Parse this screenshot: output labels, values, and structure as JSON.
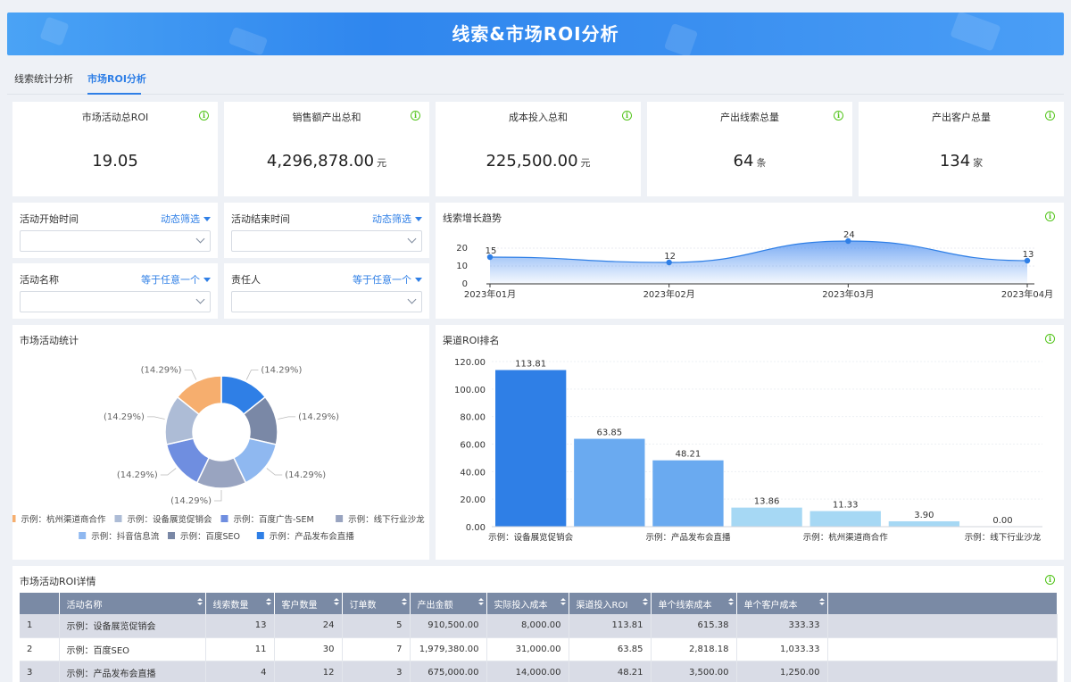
{
  "banner": {
    "title": "线索&市场ROI分析"
  },
  "tabs": [
    {
      "label": "线索统计分析"
    },
    {
      "label": "市场ROI分析"
    }
  ],
  "kpis": [
    {
      "label": "市场活动总ROI",
      "value": "19.05",
      "unit": ""
    },
    {
      "label": "销售额产出总和",
      "value": "4,296,878.00",
      "unit": "元"
    },
    {
      "label": "成本投入总和",
      "value": "225,500.00",
      "unit": "元"
    },
    {
      "label": "产出线索总量",
      "value": "64",
      "unit": "条"
    },
    {
      "label": "产出客户总量",
      "value": "134",
      "unit": "家"
    }
  ],
  "filters": [
    {
      "label": "活动开始时间",
      "mode": "动态筛选"
    },
    {
      "label": "活动结束时间",
      "mode": "动态筛选"
    },
    {
      "label": "活动名称",
      "mode": "等于任意一个"
    },
    {
      "label": "责任人",
      "mode": "等于任意一个"
    }
  ],
  "info_icon": "i",
  "colors": {
    "accent": "#2f7fe6",
    "info": "#52c41a"
  },
  "lead_trend": {
    "title": "线索增长趋势"
  },
  "activity_stats": {
    "title": "市场活动统计"
  },
  "channel_roi": {
    "title": "渠道ROI排名"
  },
  "chart_data": [
    {
      "type": "area",
      "title": "线索增长趋势",
      "x": [
        "2023年01月",
        "2023年02月",
        "2023年03月",
        "2023年04月"
      ],
      "y": [
        15,
        12,
        24,
        13
      ],
      "yticks": [
        0,
        10,
        20
      ],
      "ylim": [
        0,
        30
      ],
      "grid": true
    },
    {
      "type": "pie",
      "title": "市场活动统计",
      "donut": true,
      "legend": "bottom",
      "slices": [
        {
          "name": "示例：产品发布会直播",
          "value": 14.29,
          "label": "(14.29%)",
          "color": "#2f7fe6"
        },
        {
          "name": "示例：百度SEO",
          "value": 14.29,
          "label": "(14.29%)",
          "color": "#7a88a6"
        },
        {
          "name": "示例：抖音信息流",
          "value": 14.29,
          "label": "(14.29%)",
          "color": "#8fb8f0"
        },
        {
          "name": "示例：线下行业沙龙",
          "value": 14.29,
          "label": "(14.29%)",
          "color": "#99a4c0"
        },
        {
          "name": "示例：百度广告-SEM",
          "value": 14.29,
          "label": "(14.29%)",
          "color": "#6f8ee0"
        },
        {
          "name": "示例：设备展览促销会",
          "value": 14.29,
          "label": "(14.29%)",
          "color": "#adbcd6"
        },
        {
          "name": "示例：杭州渠道商合作",
          "value": 14.29,
          "label": "(14.29%)",
          "color": "#f6ae6e"
        }
      ],
      "legend_order": [
        "示例：杭州渠道商合作",
        "示例：设备展览促销会",
        "示例：百度广告-SEM",
        "示例：线下行业沙龙",
        "示例：抖音信息流",
        "示例：百度SEO",
        "示例：产品发布会直播"
      ]
    },
    {
      "type": "bar",
      "title": "渠道ROI排名",
      "categories": [
        "示例：设备展览促销会",
        "示例：百度SEO",
        "示例：产品发布会直播",
        "示例：抖音信息流",
        "示例：杭州渠道商合作",
        "示例：百度广告-SEM",
        "示例：线下行业沙龙"
      ],
      "values": [
        113.81,
        63.85,
        48.21,
        13.86,
        11.33,
        3.9,
        0.0
      ],
      "value_labels": [
        "113.81",
        "63.85",
        "48.21",
        "13.86",
        "11.33",
        "3.90",
        "0.00"
      ],
      "shown_xticks": [
        "示例：设备展览促销会",
        "示例：产品发布会直播",
        "示例：杭州渠道商合作",
        "示例：线下行业沙龙"
      ],
      "yticks": [
        "0.00",
        "20.00",
        "40.00",
        "60.00",
        "80.00",
        "100.00",
        "120.00"
      ],
      "ylim": [
        0,
        120
      ],
      "colors": [
        "#2f7fe6",
        "#6aaaf0",
        "#6aaaf0",
        "#a6d8f4",
        "#a6d8f4",
        "#a6d8f4",
        "#a6d8f4"
      ],
      "grid": true
    }
  ],
  "table": {
    "title": "市场活动ROI详情",
    "columns": [
      "",
      "活动名称",
      "线索数量",
      "客户数量",
      "订单数",
      "产出金额",
      "实际投入成本",
      "渠道投入ROI",
      "单个线索成本",
      "单个客户成本"
    ],
    "rows": [
      [
        "1",
        "示例：设备展览促销会",
        "13",
        "24",
        "5",
        "910,500.00",
        "8,000.00",
        "113.81",
        "615.38",
        "333.33"
      ],
      [
        "2",
        "示例：百度SEO",
        "11",
        "30",
        "7",
        "1,979,380.00",
        "31,000.00",
        "63.85",
        "2,818.18",
        "1,033.33"
      ],
      [
        "3",
        "示例：产品发布会直播",
        "4",
        "12",
        "3",
        "675,000.00",
        "14,000.00",
        "48.21",
        "3,500.00",
        "1,250.00"
      ]
    ]
  }
}
